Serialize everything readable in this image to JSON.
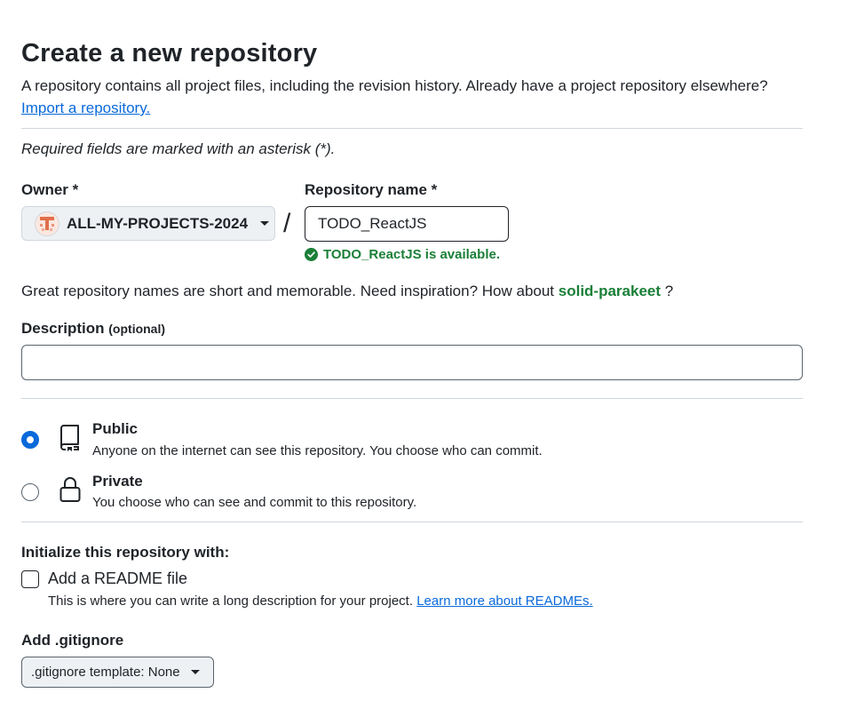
{
  "header": {
    "title": "Create a new repository",
    "subtitle": "A repository contains all project files, including the revision history. Already have a project repository elsewhere?",
    "import_link": "Import a repository."
  },
  "required_note": "Required fields are marked with an asterisk (*).",
  "owner": {
    "label": "Owner *",
    "value": "ALL-MY-PROJECTS-2024",
    "avatar_icon": "identicon-avatar"
  },
  "separator": "/",
  "repo_name": {
    "label": "Repository name *",
    "value": "TODO_ReactJS",
    "availability": "TODO_ReactJS is available."
  },
  "suggestion": {
    "prefix": "Great repository names are short and memorable. Need inspiration? How about",
    "name": "solid-parakeet",
    "suffix": "?"
  },
  "description": {
    "label": "Description",
    "optional": "(optional)",
    "value": ""
  },
  "visibility": {
    "selected": "public",
    "options": [
      {
        "id": "public",
        "title": "Public",
        "desc": "Anyone on the internet can see this repository. You choose who can commit.",
        "icon": "repo-book-icon"
      },
      {
        "id": "private",
        "title": "Private",
        "desc": "You choose who can see and commit to this repository.",
        "icon": "lock-icon"
      }
    ]
  },
  "initialize": {
    "heading": "Initialize this repository with:",
    "readme_label": "Add a README file",
    "readme_checked": false,
    "readme_desc": "This is where you can write a long description for your project.",
    "readme_link": "Learn more about READMEs."
  },
  "gitignore": {
    "label": "Add .gitignore",
    "button": ".gitignore template: None"
  },
  "colors": {
    "link": "#0969da",
    "success": "#1a7f37",
    "radio_selected": "#0969da",
    "avatar": "#e16f4b"
  }
}
